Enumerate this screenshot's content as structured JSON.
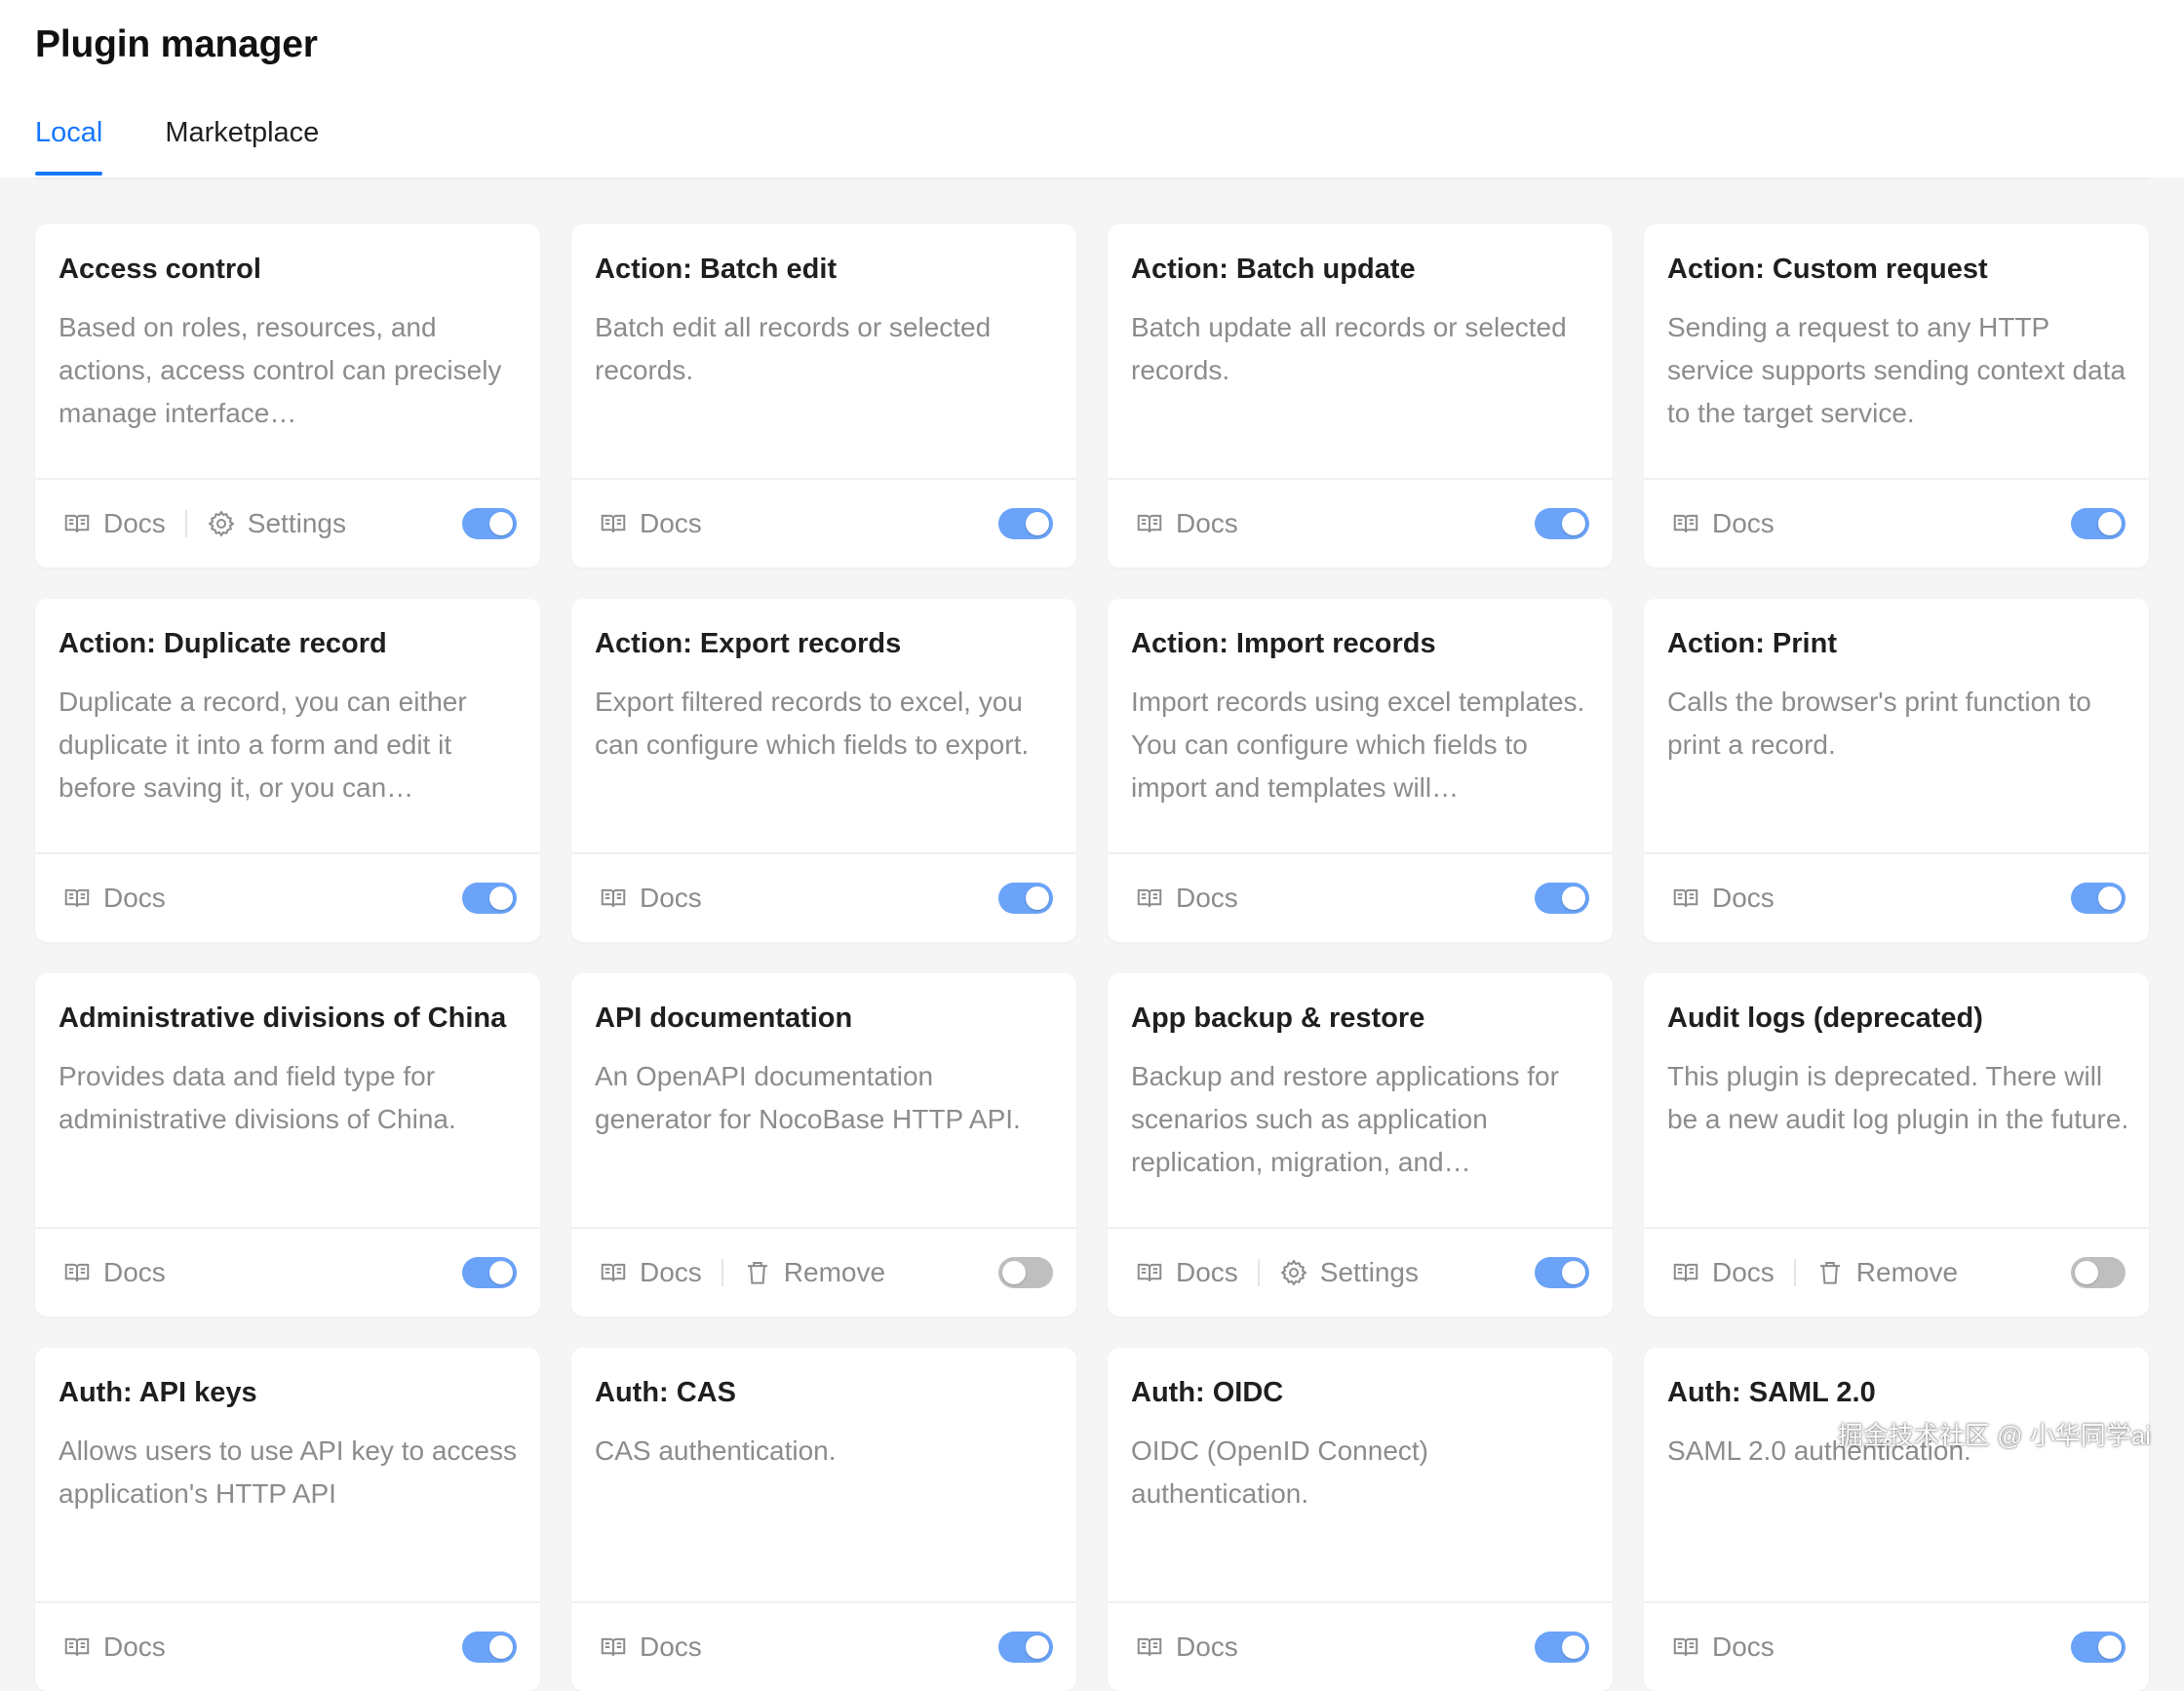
{
  "header": {
    "title": "Plugin manager",
    "tabs": [
      {
        "label": "Local",
        "active": true
      },
      {
        "label": "Marketplace",
        "active": false
      }
    ]
  },
  "labels": {
    "docs": "Docs",
    "settings": "Settings",
    "remove": "Remove"
  },
  "colors": {
    "accent": "#1677ff",
    "switch_on": "#6aa3f8",
    "switch_off": "#bfbfbf"
  },
  "plugins": [
    {
      "title": "Access control",
      "description": "Based on roles, resources, and actions, access control can precisely manage interface…",
      "actions": [
        "docs",
        "settings"
      ],
      "enabled": true
    },
    {
      "title": "Action: Batch edit",
      "description": "Batch edit all records or selected records.",
      "actions": [
        "docs"
      ],
      "enabled": true
    },
    {
      "title": "Action: Batch update",
      "description": "Batch update all records or selected records.",
      "actions": [
        "docs"
      ],
      "enabled": true
    },
    {
      "title": "Action: Custom request",
      "description": "Sending a request to any HTTP service supports sending context data to the target service.",
      "actions": [
        "docs"
      ],
      "enabled": true
    },
    {
      "title": "Action: Duplicate record",
      "description": "Duplicate a record, you can either duplicate it into a form and edit it before saving it, or you can…",
      "actions": [
        "docs"
      ],
      "enabled": true
    },
    {
      "title": "Action: Export records",
      "description": "Export filtered records to excel, you can configure which fields to export.",
      "actions": [
        "docs"
      ],
      "enabled": true
    },
    {
      "title": "Action: Import records",
      "description": "Import records using excel templates. You can configure which fields to import and templates will…",
      "actions": [
        "docs"
      ],
      "enabled": true
    },
    {
      "title": "Action: Print",
      "description": "Calls the browser's print function to print a record.",
      "actions": [
        "docs"
      ],
      "enabled": true
    },
    {
      "title": "Administrative divisions of China",
      "description": "Provides data and field type for administrative divisions of China.",
      "actions": [
        "docs"
      ],
      "enabled": true
    },
    {
      "title": "API documentation",
      "description": "An OpenAPI documentation generator for NocoBase HTTP API.",
      "actions": [
        "docs",
        "remove"
      ],
      "enabled": false
    },
    {
      "title": "App backup & restore",
      "description": "Backup and restore applications for scenarios such as application replication, migration, and…",
      "actions": [
        "docs",
        "settings"
      ],
      "enabled": true
    },
    {
      "title": "Audit logs (deprecated)",
      "description": "This plugin is deprecated. There will be a new audit log plugin in the future.",
      "actions": [
        "docs",
        "remove"
      ],
      "enabled": false
    },
    {
      "title": "Auth: API keys",
      "description": "Allows users to use API key to access application's HTTP API",
      "actions": [
        "docs"
      ],
      "enabled": true
    },
    {
      "title": "Auth: CAS",
      "description": "CAS authentication.",
      "actions": [
        "docs"
      ],
      "enabled": true
    },
    {
      "title": "Auth: OIDC",
      "description": "OIDC (OpenID Connect) authentication.",
      "actions": [
        "docs"
      ],
      "enabled": true
    },
    {
      "title": "Auth: SAML 2.0",
      "description": "SAML 2.0 authentication.",
      "actions": [
        "docs"
      ],
      "enabled": true
    }
  ],
  "watermark": "掘金技术社区 @ 小华同学ai"
}
